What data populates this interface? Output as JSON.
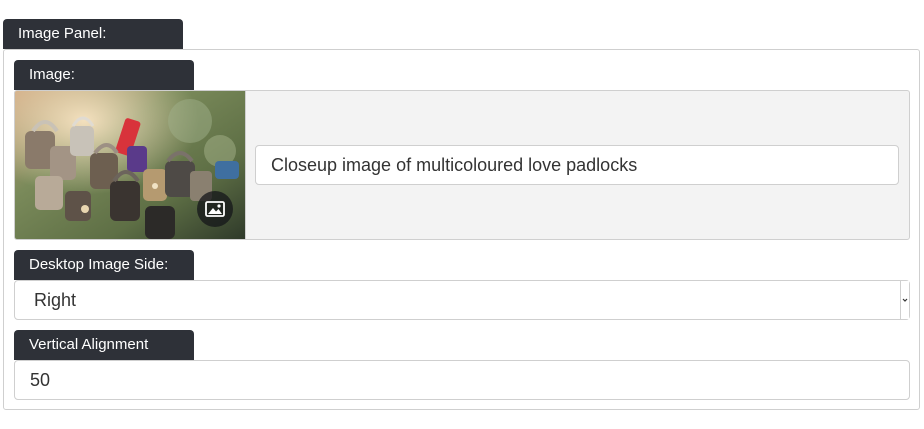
{
  "panel": {
    "title": "Image Panel:"
  },
  "image": {
    "label": "Image:",
    "alt_text": "Closeup image of multicoloured love padlocks",
    "icon": "image-icon"
  },
  "desktop_side": {
    "label": "Desktop Image Side:",
    "selected": "Right"
  },
  "vertical_alignment": {
    "label": "Vertical Alignment (%):",
    "value": "50"
  },
  "colors": {
    "tab_background": "#2e3138",
    "tab_text": "#ffffff",
    "border": "#cfcfcf",
    "image_area_background": "#f3f3f3"
  }
}
